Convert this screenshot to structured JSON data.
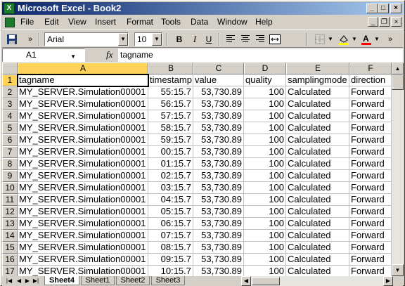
{
  "window": {
    "title": "Microsoft Excel - Book2",
    "app_icon": "excel-icon"
  },
  "menu": [
    "File",
    "Edit",
    "View",
    "Insert",
    "Format",
    "Tools",
    "Data",
    "Window",
    "Help"
  ],
  "toolbar": {
    "font": "Arial",
    "size": "10",
    "bold": "B",
    "italic": "I",
    "underline": "U",
    "fill_color": "#ffff00",
    "font_color": "#ff0000"
  },
  "formula_bar": {
    "name_box": "A1",
    "fx": "fx",
    "content": "tagname"
  },
  "columns": [
    "A",
    "B",
    "C",
    "D",
    "E",
    "F"
  ],
  "headers": [
    "tagname",
    "timestamp",
    "value",
    "quality",
    "samplingmode",
    "direction"
  ],
  "rows": [
    {
      "n": "2",
      "tag": "MY_SERVER.Simulation00001",
      "ts": "55:15.7",
      "value": "53,730.89",
      "quality": "100",
      "mode": "Calculated",
      "dir": "Forward"
    },
    {
      "n": "3",
      "tag": "MY_SERVER.Simulation00001",
      "ts": "56:15.7",
      "value": "53,730.89",
      "quality": "100",
      "mode": "Calculated",
      "dir": "Forward"
    },
    {
      "n": "4",
      "tag": "MY_SERVER.Simulation00001",
      "ts": "57:15.7",
      "value": "53,730.89",
      "quality": "100",
      "mode": "Calculated",
      "dir": "Forward"
    },
    {
      "n": "5",
      "tag": "MY_SERVER.Simulation00001",
      "ts": "58:15.7",
      "value": "53,730.89",
      "quality": "100",
      "mode": "Calculated",
      "dir": "Forward"
    },
    {
      "n": "6",
      "tag": "MY_SERVER.Simulation00001",
      "ts": "59:15.7",
      "value": "53,730.89",
      "quality": "100",
      "mode": "Calculated",
      "dir": "Forward"
    },
    {
      "n": "7",
      "tag": "MY_SERVER.Simulation00001",
      "ts": "00:15.7",
      "value": "53,730.89",
      "quality": "100",
      "mode": "Calculated",
      "dir": "Forward"
    },
    {
      "n": "8",
      "tag": "MY_SERVER.Simulation00001",
      "ts": "01:15.7",
      "value": "53,730.89",
      "quality": "100",
      "mode": "Calculated",
      "dir": "Forward"
    },
    {
      "n": "9",
      "tag": "MY_SERVER.Simulation00001",
      "ts": "02:15.7",
      "value": "53,730.89",
      "quality": "100",
      "mode": "Calculated",
      "dir": "Forward"
    },
    {
      "n": "10",
      "tag": "MY_SERVER.Simulation00001",
      "ts": "03:15.7",
      "value": "53,730.89",
      "quality": "100",
      "mode": "Calculated",
      "dir": "Forward"
    },
    {
      "n": "11",
      "tag": "MY_SERVER.Simulation00001",
      "ts": "04:15.7",
      "value": "53,730.89",
      "quality": "100",
      "mode": "Calculated",
      "dir": "Forward"
    },
    {
      "n": "12",
      "tag": "MY_SERVER.Simulation00001",
      "ts": "05:15.7",
      "value": "53,730.89",
      "quality": "100",
      "mode": "Calculated",
      "dir": "Forward"
    },
    {
      "n": "13",
      "tag": "MY_SERVER.Simulation00001",
      "ts": "06:15.7",
      "value": "53,730.89",
      "quality": "100",
      "mode": "Calculated",
      "dir": "Forward"
    },
    {
      "n": "14",
      "tag": "MY_SERVER.Simulation00001",
      "ts": "07:15.7",
      "value": "53,730.89",
      "quality": "100",
      "mode": "Calculated",
      "dir": "Forward"
    },
    {
      "n": "15",
      "tag": "MY_SERVER.Simulation00001",
      "ts": "08:15.7",
      "value": "53,730.89",
      "quality": "100",
      "mode": "Calculated",
      "dir": "Forward"
    },
    {
      "n": "16",
      "tag": "MY_SERVER.Simulation00001",
      "ts": "09:15.7",
      "value": "53,730.89",
      "quality": "100",
      "mode": "Calculated",
      "dir": "Forward"
    },
    {
      "n": "17",
      "tag": "MY_SERVER.Simulation00001",
      "ts": "10:15.7",
      "value": "53,730.89",
      "quality": "100",
      "mode": "Calculated",
      "dir": "Forward"
    }
  ],
  "header_row_number": "1",
  "sheets": [
    "Sheet4",
    "Sheet1",
    "Sheet2",
    "Sheet3"
  ],
  "active_sheet": "Sheet4"
}
